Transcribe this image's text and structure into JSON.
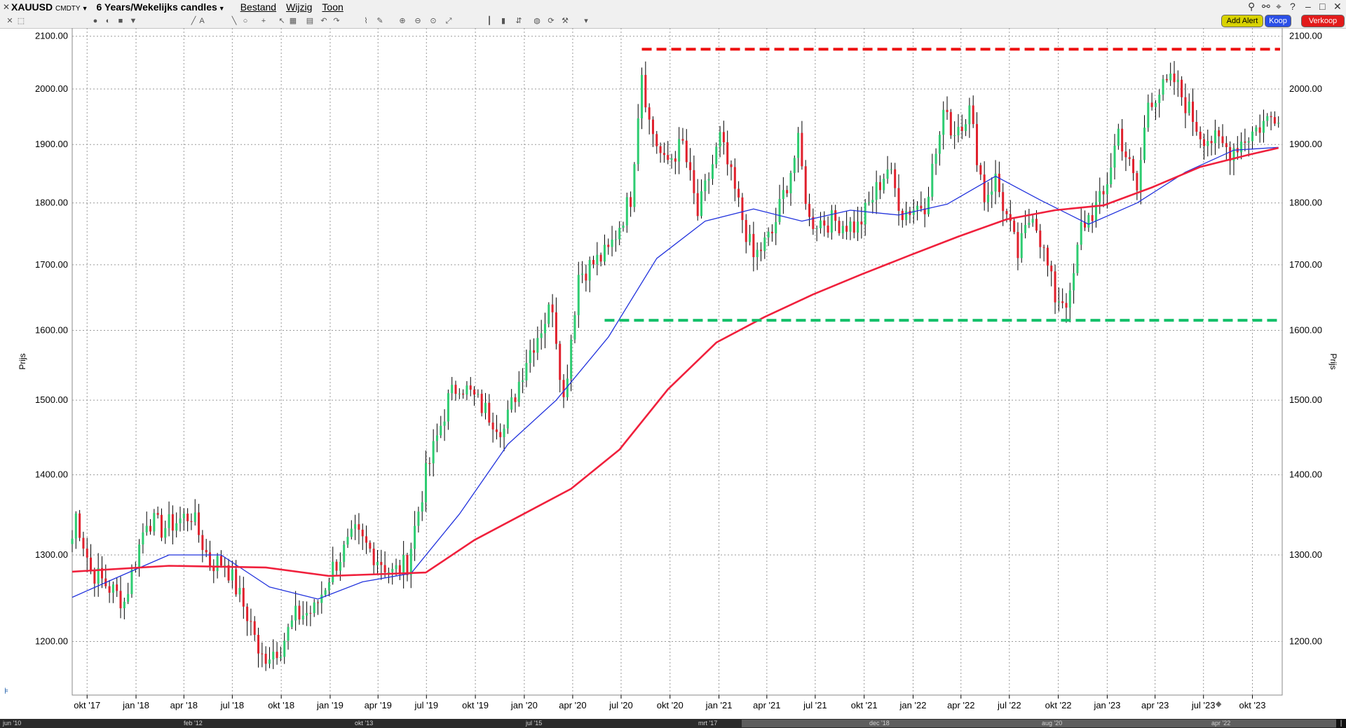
{
  "header": {
    "symbol": "XAUUSD",
    "symbol_suffix": "CMDTY",
    "timeframe": "6 Years/Wekelijks candles",
    "menus": [
      "Bestand",
      "Wijzig",
      "Toon"
    ],
    "buttons": {
      "alert": "Add Alert",
      "buy": "Koop",
      "sell": "Verkoop"
    }
  },
  "toolbar_icons": [
    "crosshair-icon",
    "zoom-box-icon",
    "color-circle-icon",
    "contrast-icon",
    "square-icon",
    "arrow-down-icon",
    "pencil-icon",
    "text-icon",
    "line-icon",
    "circle-icon",
    "plus-icon",
    "select-icon",
    "table-icon",
    "calendar-icon",
    "undo-icon",
    "redo-icon",
    "fib-icon",
    "edit-icon",
    "zoom-in-icon",
    "zoom-out-icon",
    "zoom-reset-icon",
    "fit-icon",
    "bars-icon",
    "candles-icon",
    "spread-icon",
    "globe-icon",
    "refresh-icon",
    "wrench-icon",
    "more-icon"
  ],
  "chart_data": {
    "type": "candlestick",
    "title": "XAUUSD CMDTY 6 Years/Wekelijks candles",
    "ylabel": "Prijs",
    "ylim": [
      1142,
      2116
    ],
    "yscale": "log",
    "yticks": [
      1200,
      1300,
      1400,
      1500,
      1600,
      1700,
      1800,
      1900,
      2000,
      2100
    ],
    "ytick_labels": [
      "1200.00",
      "1300.00",
      "1400.00",
      "1500.00",
      "1600.00",
      "1700.00",
      "1800.00",
      "1900.00",
      "2000.00",
      "2100.00"
    ],
    "x_start": "2017-09-03",
    "x_end": "2023-11-26",
    "xticks": [
      {
        "date": "2017-10-01",
        "label": "okt '17"
      },
      {
        "date": "2018-01-01",
        "label": "jan '18"
      },
      {
        "date": "2018-04-01",
        "label": "apr '18"
      },
      {
        "date": "2018-07-01",
        "label": "jul '18"
      },
      {
        "date": "2018-10-01",
        "label": "okt '18"
      },
      {
        "date": "2019-01-01",
        "label": "jan '19"
      },
      {
        "date": "2019-04-01",
        "label": "apr '19"
      },
      {
        "date": "2019-07-01",
        "label": "jul '19"
      },
      {
        "date": "2019-10-01",
        "label": "okt '19"
      },
      {
        "date": "2020-01-01",
        "label": "jan '20"
      },
      {
        "date": "2020-04-01",
        "label": "apr '20"
      },
      {
        "date": "2020-07-01",
        "label": "jul '20"
      },
      {
        "date": "2020-10-01",
        "label": "okt '20"
      },
      {
        "date": "2021-01-01",
        "label": "jan '21"
      },
      {
        "date": "2021-04-01",
        "label": "apr '21"
      },
      {
        "date": "2021-07-01",
        "label": "jul '21"
      },
      {
        "date": "2021-10-01",
        "label": "okt '21"
      },
      {
        "date": "2022-01-01",
        "label": "jan '22"
      },
      {
        "date": "2022-04-01",
        "label": "apr '22"
      },
      {
        "date": "2022-07-01",
        "label": "jul '22"
      },
      {
        "date": "2022-10-01",
        "label": "okt '22"
      },
      {
        "date": "2023-01-01",
        "label": "jan '23"
      },
      {
        "date": "2023-04-01",
        "label": "apr '23"
      },
      {
        "date": "2023-07-01",
        "label": "jul '23"
      },
      {
        "date": "2023-10-01",
        "label": "okt '23"
      }
    ],
    "grid": true,
    "colors": {
      "up": "#2ecc71",
      "down": "#e0202c",
      "wick": "#000000",
      "ma_short": "#2233dd",
      "ma_long": "#f0203c",
      "resistance": "#ee1111",
      "support": "#14c06a"
    },
    "key_points": [
      {
        "date": "2017-09-03",
        "price": 1320
      },
      {
        "date": "2017-09-10",
        "price": 1349
      },
      {
        "date": "2017-10-08",
        "price": 1282
      },
      {
        "date": "2017-12-10",
        "price": 1245
      },
      {
        "date": "2018-01-21",
        "price": 1345
      },
      {
        "date": "2018-02-18",
        "price": 1332
      },
      {
        "date": "2018-04-15",
        "price": 1350
      },
      {
        "date": "2018-05-20",
        "price": 1290
      },
      {
        "date": "2018-06-17",
        "price": 1292
      },
      {
        "date": "2018-08-12",
        "price": 1210
      },
      {
        "date": "2018-08-19",
        "price": 1180
      },
      {
        "date": "2018-09-30",
        "price": 1195
      },
      {
        "date": "2018-10-28",
        "price": 1228
      },
      {
        "date": "2018-12-02",
        "price": 1235
      },
      {
        "date": "2019-01-06",
        "price": 1285
      },
      {
        "date": "2019-02-17",
        "price": 1325
      },
      {
        "date": "2019-04-28",
        "price": 1278
      },
      {
        "date": "2019-05-26",
        "price": 1290
      },
      {
        "date": "2019-06-30",
        "price": 1400
      },
      {
        "date": "2019-08-11",
        "price": 1500
      },
      {
        "date": "2019-09-01",
        "price": 1525
      },
      {
        "date": "2019-10-27",
        "price": 1480
      },
      {
        "date": "2019-11-24",
        "price": 1460
      },
      {
        "date": "2020-01-05",
        "price": 1560
      },
      {
        "date": "2020-02-23",
        "price": 1640
      },
      {
        "date": "2020-03-15",
        "price": 1500
      },
      {
        "date": "2020-04-12",
        "price": 1685
      },
      {
        "date": "2020-06-07",
        "price": 1720
      },
      {
        "date": "2020-07-19",
        "price": 1810
      },
      {
        "date": "2020-08-02",
        "price": 1960
      },
      {
        "date": "2020-08-09",
        "price": 2035
      },
      {
        "date": "2020-08-23",
        "price": 1940
      },
      {
        "date": "2020-09-20",
        "price": 1865
      },
      {
        "date": "2020-10-25",
        "price": 1900
      },
      {
        "date": "2020-11-22",
        "price": 1780
      },
      {
        "date": "2021-01-03",
        "price": 1910
      },
      {
        "date": "2021-03-07",
        "price": 1710
      },
      {
        "date": "2021-04-11",
        "price": 1750
      },
      {
        "date": "2021-05-30",
        "price": 1900
      },
      {
        "date": "2021-06-20",
        "price": 1770
      },
      {
        "date": "2021-08-08",
        "price": 1770
      },
      {
        "date": "2021-09-19",
        "price": 1760
      },
      {
        "date": "2021-11-14",
        "price": 1860
      },
      {
        "date": "2021-12-12",
        "price": 1785
      },
      {
        "date": "2022-01-23",
        "price": 1800
      },
      {
        "date": "2022-03-06",
        "price": 1975
      },
      {
        "date": "2022-03-13",
        "price": 1920
      },
      {
        "date": "2022-04-17",
        "price": 1960
      },
      {
        "date": "2022-05-15",
        "price": 1810
      },
      {
        "date": "2022-06-05",
        "price": 1840
      },
      {
        "date": "2022-07-17",
        "price": 1715
      },
      {
        "date": "2022-08-14",
        "price": 1790
      },
      {
        "date": "2022-09-25",
        "price": 1650
      },
      {
        "date": "2022-10-23",
        "price": 1645
      },
      {
        "date": "2022-11-13",
        "price": 1760
      },
      {
        "date": "2022-12-25",
        "price": 1810
      },
      {
        "date": "2023-01-22",
        "price": 1925
      },
      {
        "date": "2023-02-26",
        "price": 1820
      },
      {
        "date": "2023-03-19",
        "price": 1980
      },
      {
        "date": "2023-05-07",
        "price": 2015
      },
      {
        "date": "2023-06-25",
        "price": 1920
      },
      {
        "date": "2023-08-20",
        "price": 1890
      },
      {
        "date": "2023-11-19",
        "price": 1960
      }
    ],
    "series": [
      {
        "style": "line",
        "points": [
          [
            "2017-09-03",
            1250
          ],
          [
            "2017-12-03",
            1275
          ],
          [
            "2018-03-04",
            1300
          ],
          [
            "2018-06-10",
            1300
          ],
          [
            "2018-09-09",
            1262
          ],
          [
            "2018-12-09",
            1248
          ],
          [
            "2019-03-03",
            1268
          ],
          [
            "2019-06-02",
            1278
          ],
          [
            "2019-09-01",
            1350
          ],
          [
            "2019-12-01",
            1440
          ],
          [
            "2020-03-01",
            1500
          ],
          [
            "2020-06-07",
            1590
          ],
          [
            "2020-09-06",
            1710
          ],
          [
            "2020-12-06",
            1770
          ],
          [
            "2021-03-07",
            1790
          ],
          [
            "2021-06-06",
            1770
          ],
          [
            "2021-09-05",
            1788
          ],
          [
            "2021-12-05",
            1780
          ],
          [
            "2022-03-06",
            1798
          ],
          [
            "2022-06-05",
            1845
          ],
          [
            "2022-08-28",
            1805
          ],
          [
            "2022-11-27",
            1765
          ],
          [
            "2023-02-26",
            1800
          ],
          [
            "2023-05-28",
            1852
          ],
          [
            "2023-08-27",
            1890
          ],
          [
            "2023-11-19",
            1895
          ]
        ]
      },
      {
        "style": "line",
        "points": [
          [
            "2017-09-03",
            1280
          ],
          [
            "2018-03-04",
            1287
          ],
          [
            "2018-09-02",
            1285
          ],
          [
            "2018-12-30",
            1275
          ],
          [
            "2019-06-30",
            1279
          ],
          [
            "2019-09-29",
            1318
          ],
          [
            "2020-03-29",
            1382
          ],
          [
            "2020-06-28",
            1433
          ],
          [
            "2020-09-27",
            1515
          ],
          [
            "2020-12-27",
            1582
          ],
          [
            "2021-03-28",
            1620
          ],
          [
            "2021-06-27",
            1654
          ],
          [
            "2021-09-26",
            1685
          ],
          [
            "2021-12-26",
            1715
          ],
          [
            "2022-03-27",
            1745
          ],
          [
            "2022-06-26",
            1773
          ],
          [
            "2022-09-25",
            1788
          ],
          [
            "2022-12-25",
            1796
          ],
          [
            "2023-03-26",
            1826
          ],
          [
            "2023-06-25",
            1861
          ],
          [
            "2023-09-24",
            1882
          ],
          [
            "2023-11-19",
            1894
          ]
        ]
      }
    ],
    "annotations": [
      {
        "type": "hline",
        "price": 2075,
        "from": "2020-08-09",
        "to": "2023-11-26"
      },
      {
        "type": "hline",
        "price": 1615,
        "from": "2020-05-31",
        "to": "2023-11-26"
      }
    ]
  },
  "navigator": {
    "labels": [
      "jun '10",
      "feb '12",
      "okt '13",
      "jul '15",
      "mrt '17",
      "dec '18",
      "aug '20",
      "apr '22"
    ]
  }
}
